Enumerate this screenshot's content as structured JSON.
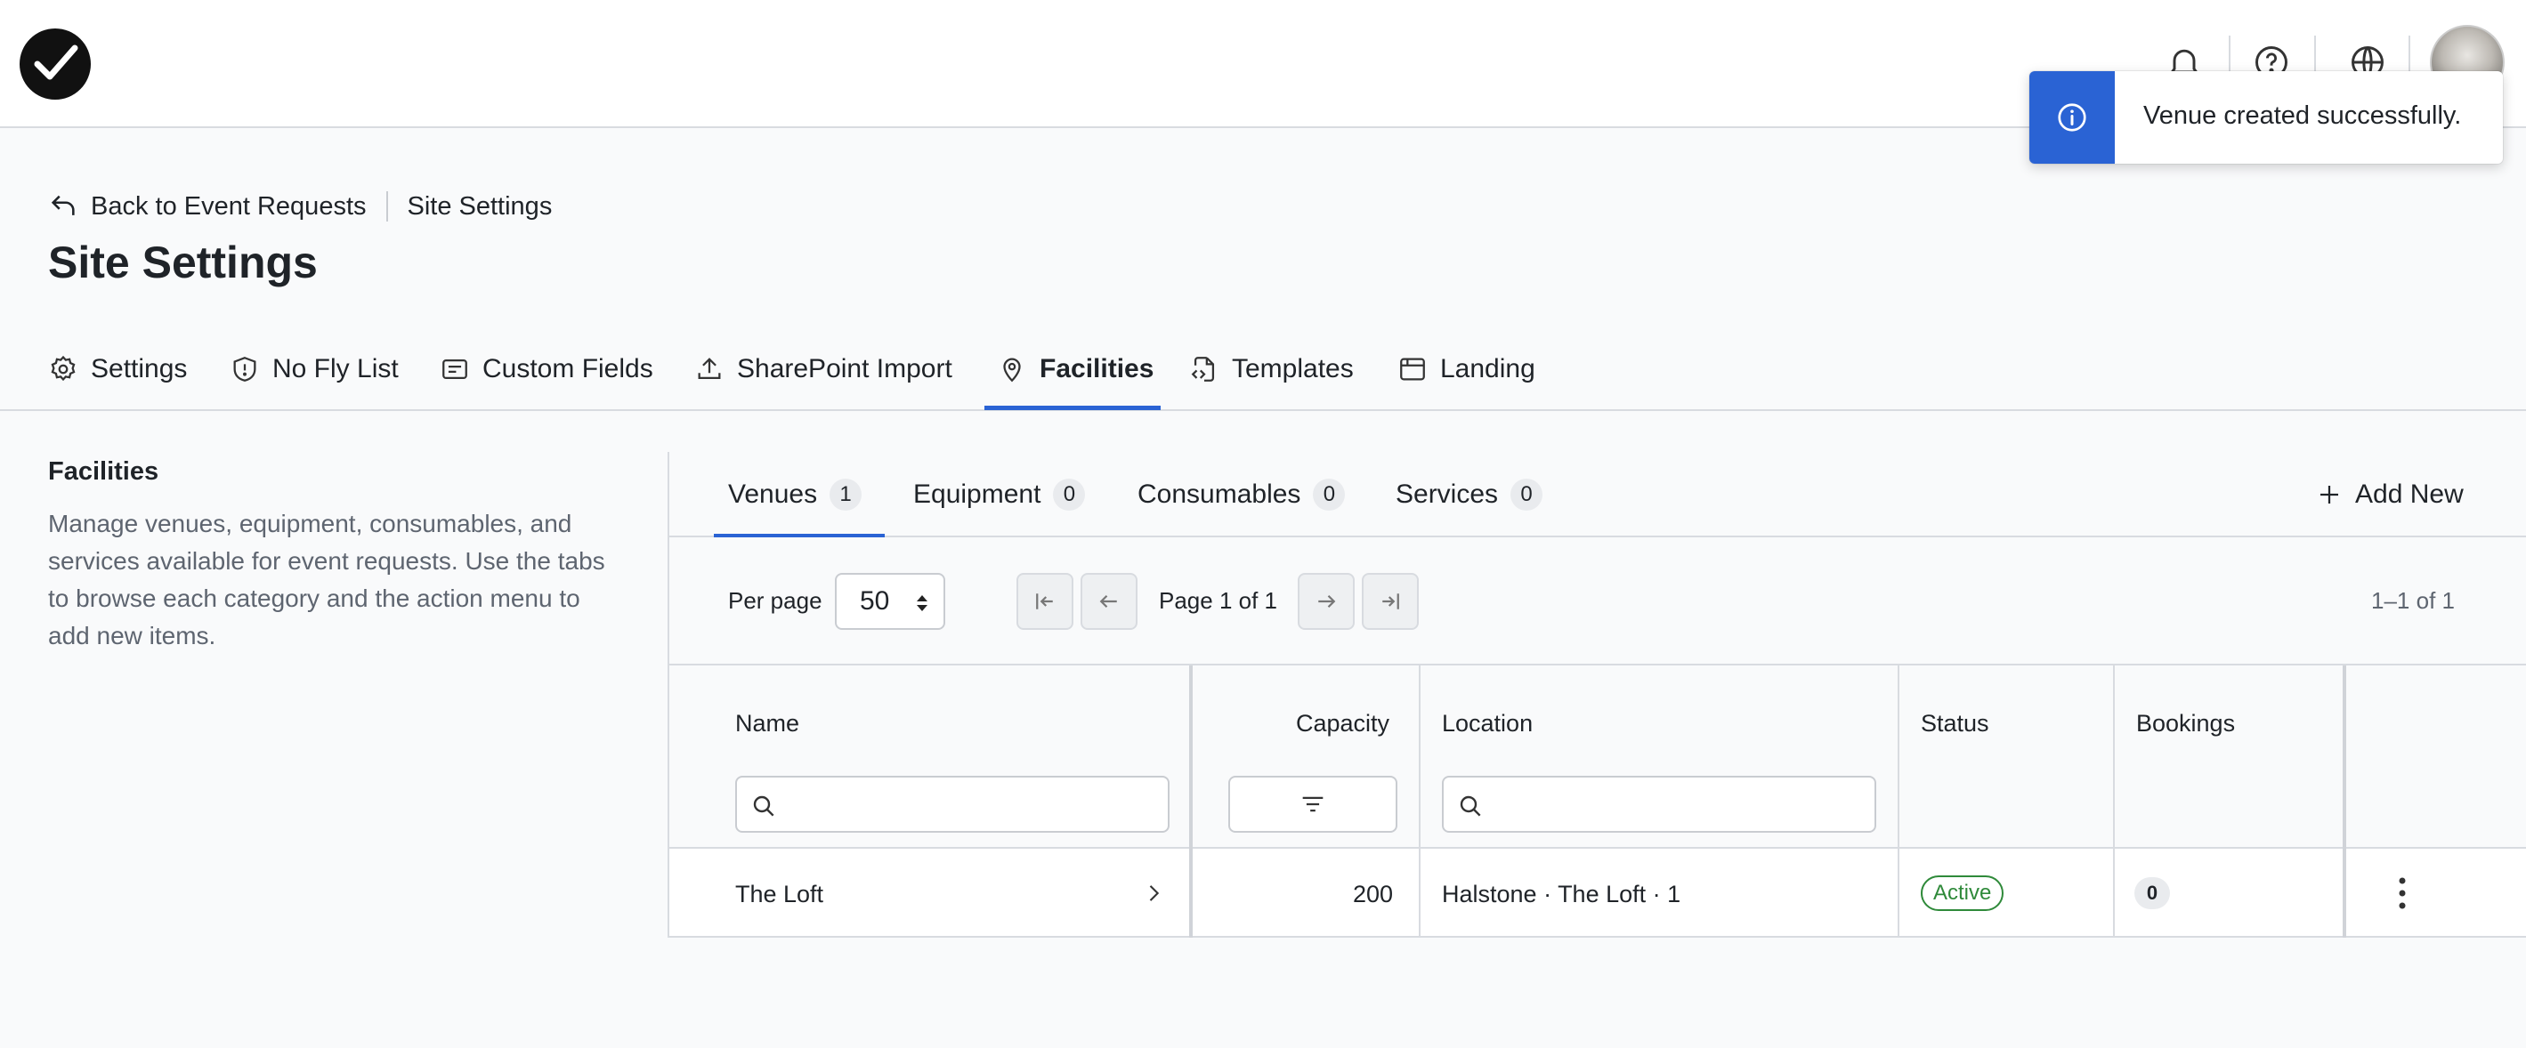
{
  "toast": {
    "message": "Venue created successfully."
  },
  "header": {
    "back_label": "Back to Event Requests",
    "crumb": "Site Settings",
    "title": "Site Settings"
  },
  "main_tabs": [
    {
      "label": "Settings",
      "icon": "gear-icon"
    },
    {
      "label": "No Fly List",
      "icon": "shield-icon"
    },
    {
      "label": "Custom Fields",
      "icon": "form-icon"
    },
    {
      "label": "SharePoint Import",
      "icon": "upload-icon"
    },
    {
      "label": "Facilities",
      "icon": "map-pin-icon",
      "active": true
    },
    {
      "label": "Templates",
      "icon": "file-code-icon"
    },
    {
      "label": "Landing",
      "icon": "browser-window-icon"
    }
  ],
  "info": {
    "title": "Facilities",
    "description": "Manage venues, equipment, consumables, and services available for event requests. Use the tabs to browse each category and the action menu to add new items."
  },
  "sub_tabs": [
    {
      "label": "Venues",
      "count": "1",
      "active": true
    },
    {
      "label": "Equipment",
      "count": "0"
    },
    {
      "label": "Consumables",
      "count": "0"
    },
    {
      "label": "Services",
      "count": "0"
    }
  ],
  "add_new_label": "Add New",
  "pagination": {
    "per_page_label": "Per page",
    "per_page_value": "50",
    "page_info": "Page 1 of 1",
    "range": "1–1 of 1"
  },
  "table": {
    "columns": [
      "Name",
      "Capacity",
      "Location",
      "Status",
      "Bookings"
    ],
    "rows": [
      {
        "name": "The Loft",
        "capacity": "200",
        "location": "Halstone · The Loft · 1",
        "status": "Active",
        "bookings": "0"
      }
    ]
  },
  "colors": {
    "accent": "#2a63d4",
    "active_status": "#2f8a3a"
  }
}
